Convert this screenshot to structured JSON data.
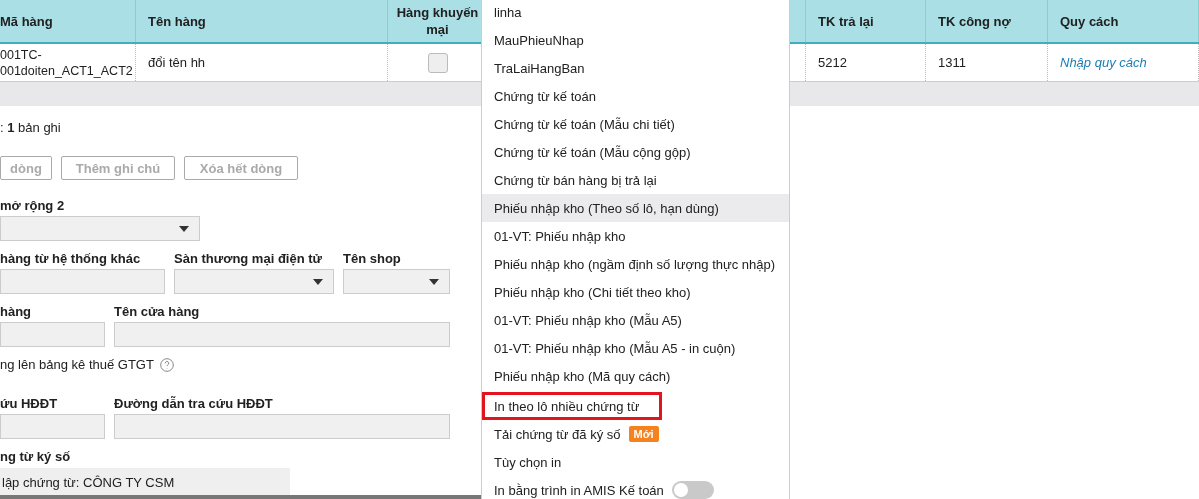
{
  "table": {
    "columns": [
      {
        "label": "Mã hàng"
      },
      {
        "label": "Tên hàng"
      },
      {
        "label": "Hàng khuyến mại"
      },
      {
        "label": "TK trả lại"
      },
      {
        "label": "TK công nợ"
      },
      {
        "label": "Quy cách"
      }
    ],
    "rows": [
      {
        "code": "001TC-001doiten_ACT1_ACT2",
        "name": "đổi tên hh",
        "promo": false,
        "return_account": "5212",
        "debt_account": "1311",
        "spec": "Nhập quy cách"
      }
    ]
  },
  "record_count": ": **1** bản ghi",
  "buttons": [
    "dòng",
    "Thêm ghi chú",
    "Xóa hết dòng"
  ],
  "form": [
    {
      "kind": "fields",
      "fields": [
        {
          "label": "mở rộng 2",
          "kind": "select"
        }
      ]
    },
    {
      "kind": "fields",
      "fields": [
        {
          "label": "hàng từ hệ thống khác",
          "kind": "text"
        },
        {
          "label": "Sàn thương mại điện tử",
          "kind": "select"
        },
        {
          "label": "Tên shop",
          "kind": "select"
        }
      ]
    },
    {
      "kind": "fields",
      "fields": [
        {
          "label": "hàng",
          "kind": "text"
        },
        {
          "label": "Tên cửa hàng",
          "kind": "text"
        }
      ]
    },
    {
      "kind": "option",
      "label": "ng lên bảng kê thuế GTGT"
    },
    {
      "kind": "fields",
      "fields": [
        {
          "label": "ứu HĐĐT",
          "kind": "text"
        },
        {
          "label": "Đường dẫn tra cứu HĐĐT",
          "kind": "text"
        }
      ]
    },
    {
      "kind": "fields",
      "fields": [
        {
          "label": "ng từ ký số",
          "kind": "readonly",
          "value": "lập chứng từ: CÔNG TY CSM"
        }
      ]
    }
  ],
  "menu": {
    "groups": [
      [
        {
          "kind": "item",
          "label": "linha",
          "selected": false,
          "marked": false
        },
        {
          "kind": "item",
          "label": "MauPhieuNhap",
          "selected": false,
          "marked": false
        },
        {
          "kind": "item",
          "label": "TraLaiHangBan",
          "selected": false,
          "marked": false
        },
        {
          "kind": "item",
          "label": "Chứng từ kế toán",
          "selected": false,
          "marked": false
        },
        {
          "kind": "item",
          "label": "Chứng từ kế toán (Mẫu chi tiết)",
          "selected": false,
          "marked": false
        },
        {
          "kind": "item",
          "label": "Chứng từ kế toán (Mẫu cộng gộp)",
          "selected": false,
          "marked": false
        },
        {
          "kind": "item",
          "label": "Chứng từ bán hàng bị trả lại",
          "selected": false,
          "marked": false
        },
        {
          "kind": "item",
          "label": "Phiếu nhập kho (Theo số lô, hạn dùng)",
          "selected": true,
          "marked": false
        },
        {
          "kind": "item",
          "label": "01-VT: Phiếu nhập kho",
          "selected": false,
          "marked": false
        },
        {
          "kind": "item",
          "label": "Phiếu nhập kho (ngầm định số lượng thực nhập)",
          "selected": false,
          "marked": false
        },
        {
          "kind": "item",
          "label": "Phiếu nhập kho (Chi tiết theo kho)",
          "selected": false,
          "marked": false
        },
        {
          "kind": "item",
          "label": "01-VT: Phiếu nhập kho (Mẫu A5)",
          "selected": false,
          "marked": false
        },
        {
          "kind": "item",
          "label": "01-VT: Phiếu nhập kho (Mẫu A5 - in cuộn)",
          "selected": false,
          "marked": false
        },
        {
          "kind": "item",
          "label": "Phiếu nhập kho (Mã quy cách)",
          "selected": false,
          "marked": false
        }
      ],
      [
        {
          "kind": "item",
          "label": "In theo lô nhiều chứng từ",
          "selected": false,
          "marked": true
        },
        {
          "kind": "badge",
          "label": "Tải chứng từ đã ký số",
          "badge": "Mới",
          "selected": false,
          "marked": false
        },
        {
          "kind": "item",
          "label": "Tùy chọn in",
          "selected": false,
          "marked": false
        },
        {
          "kind": "toggle",
          "label": "In bằng trình in AMIS Kế toán",
          "on": false,
          "selected": false,
          "marked": false
        }
      ]
    ]
  }
}
